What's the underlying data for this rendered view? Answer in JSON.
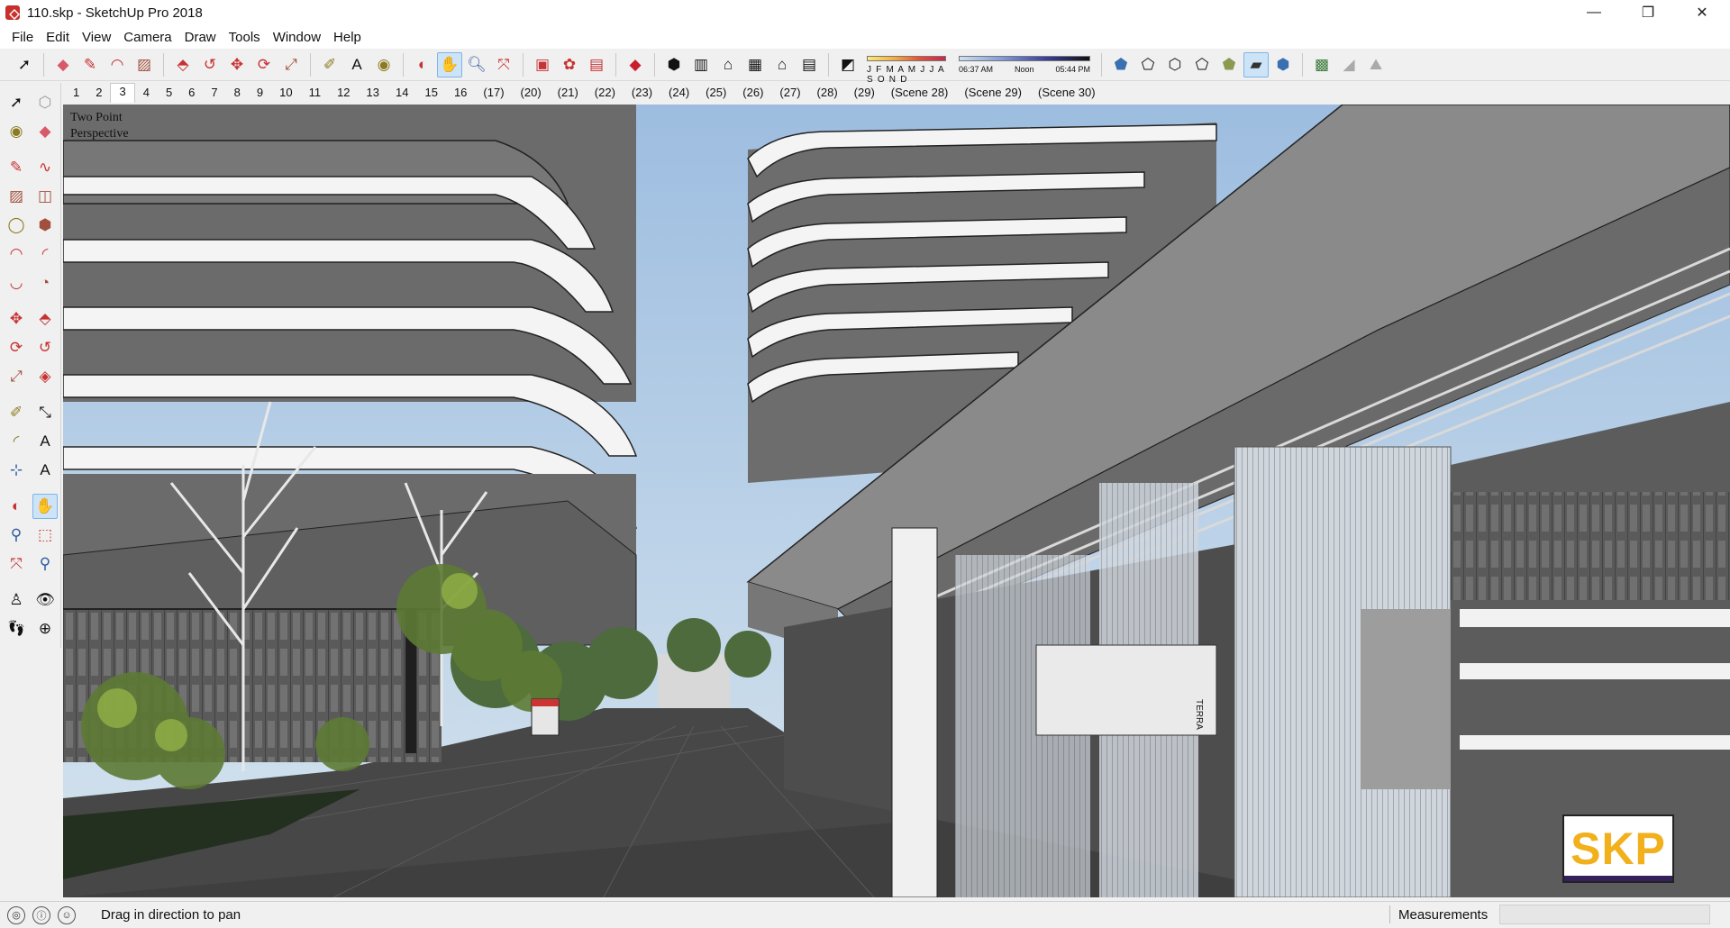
{
  "window": {
    "title": "110.skp - SketchUp Pro 2018",
    "controls": [
      "—",
      "❐",
      "✕"
    ]
  },
  "menu": [
    "File",
    "Edit",
    "View",
    "Camera",
    "Draw",
    "Tools",
    "Window",
    "Help"
  ],
  "toolbar": {
    "icons": [
      "select-icon",
      "eraser-icon",
      "pencil-icon",
      "arc-icon",
      "rectangle-icon",
      "pushpull-icon",
      "followme-icon",
      "move-icon",
      "rotate-icon",
      "scale-icon",
      "tape-icon",
      "text-icon",
      "paint-icon",
      "orbit-icon",
      "pan-icon",
      "zoom-icon",
      "zoom-extents-icon",
      "warehouse-icon",
      "extension-icon",
      "sandbox-icon",
      "ruby-icon",
      "iso-view-icon",
      "top-view-icon",
      "front-view-icon",
      "right-view-icon",
      "back-view-icon",
      "left-view-icon",
      "shadow-toggle-icon"
    ],
    "shadow_months": "J F M A M J J A S O N D",
    "shadow_time_start": "06:37 AM",
    "shadow_time_mid": "Noon",
    "shadow_time_end": "05:44 PM"
  },
  "scene_tabs": [
    "1",
    "2",
    "3",
    "4",
    "5",
    "6",
    "7",
    "8",
    "9",
    "10",
    "11",
    "12",
    "13",
    "14",
    "15",
    "16",
    "(17)",
    "(20)",
    "(21)",
    "(22)",
    "(23)",
    "(24)",
    "(25)",
    "(26)",
    "(27)",
    "(28)",
    "(29)",
    "(Scene 28)",
    "(Scene 29)",
    "(Scene 30)"
  ],
  "active_scene": "3",
  "viewport": {
    "label_line1": "Two Point",
    "label_line2": "Perspective",
    "logo_text": "SKP",
    "sign_text": "TERRA"
  },
  "status": {
    "message": "Drag in direction to pan",
    "measurements_label": "Measurements",
    "measurements_value": ""
  },
  "colors": {
    "sky": "#a9c6e3",
    "ground": "#4a4a4a",
    "building_gray": "#6d6d6d",
    "accent_logo": "#f1b01c",
    "active_tool": "#cde4f7"
  }
}
